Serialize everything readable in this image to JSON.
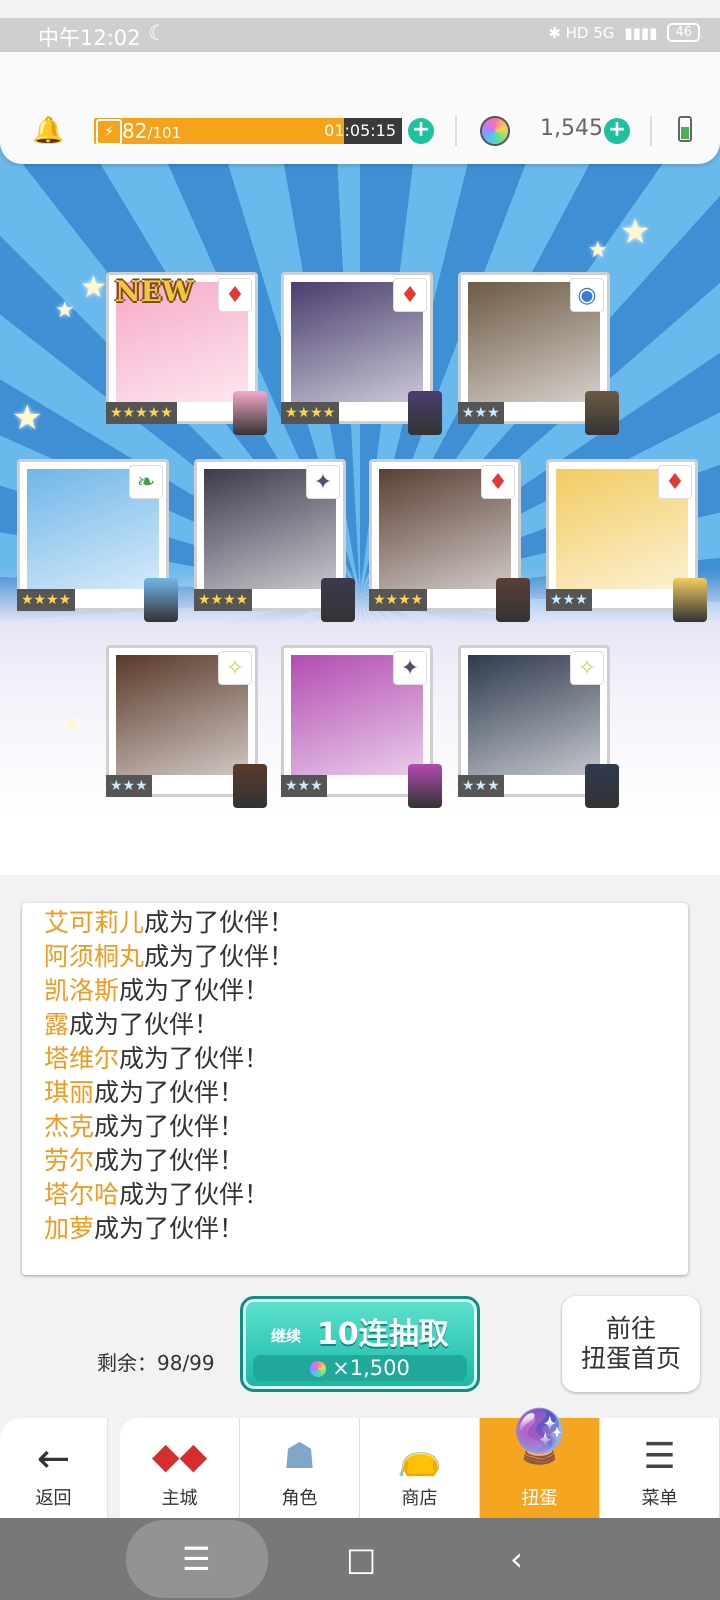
{
  "status_bar": {
    "time": "中午12:02",
    "moon": "☾",
    "indicators": "✱  HD  5G",
    "battery": "46"
  },
  "header": {
    "stamina_current": "82",
    "stamina_max": "/101",
    "stamina_timer": "01:05:15",
    "gems": "1,545"
  },
  "cards": [
    {
      "new_label": "NEW",
      "attr": "♦",
      "attr_color": "#e53935",
      "stars": "★★★★★",
      "silver": false,
      "bg": "#f6a9c9"
    },
    {
      "new_label": "",
      "attr": "♦",
      "attr_color": "#e53935",
      "stars": "★★★★",
      "silver": false,
      "bg": "#4a3e6e"
    },
    {
      "new_label": "",
      "attr": "◉",
      "attr_color": "#3a7bd5",
      "stars": "★★★",
      "silver": true,
      "bg": "#6e5a45"
    },
    {
      "new_label": "",
      "attr": "❧",
      "attr_color": "#43a047",
      "stars": "★★★★",
      "silver": false,
      "bg": "#6fb6e8"
    },
    {
      "new_label": "",
      "attr": "✦",
      "attr_color": "#5e4a6e",
      "stars": "★★★★",
      "silver": false,
      "bg": "#3e3a4e"
    },
    {
      "new_label": "",
      "attr": "♦",
      "attr_color": "#e53935",
      "stars": "★★★★",
      "silver": false,
      "bg": "#5a4034"
    },
    {
      "new_label": "",
      "attr": "♦",
      "attr_color": "#e53935",
      "stars": "★★★",
      "silver": true,
      "bg": "#f2cc62"
    },
    {
      "new_label": "",
      "attr": "✧",
      "attr_color": "#c6d84a",
      "stars": "★★★",
      "silver": true,
      "bg": "#5a3a2a"
    },
    {
      "new_label": "",
      "attr": "✦",
      "attr_color": "#5e4a6e",
      "stars": "★★★",
      "silver": true,
      "bg": "#b24cb2"
    },
    {
      "new_label": "",
      "attr": "✧",
      "attr_color": "#c6d84a",
      "stars": "★★★",
      "silver": true,
      "bg": "#2f3a4e"
    }
  ],
  "log": {
    "suffix": "成为了伙伴！",
    "names": [
      "艾可莉儿",
      "阿须桐丸",
      "凯洛斯",
      "露",
      "塔维尔",
      "琪丽",
      "杰克",
      "劳尔",
      "塔尔哈",
      "加萝"
    ]
  },
  "pull": {
    "remaining": "剩余：98/99",
    "continue_label": "继续",
    "title": "10连抽取",
    "cost": "×1,500"
  },
  "goto_label_line1": "前往",
  "goto_label_line2": "扭蛋首页",
  "nav": {
    "back": "返回",
    "home": "主城",
    "characters": "角色",
    "shop": "商店",
    "gacha": "扭蛋",
    "menu": "菜单"
  },
  "colors": {
    "accent_orange": "#f6a521",
    "teal": "#1ec2a0",
    "name_orange": "#f29a1f"
  }
}
